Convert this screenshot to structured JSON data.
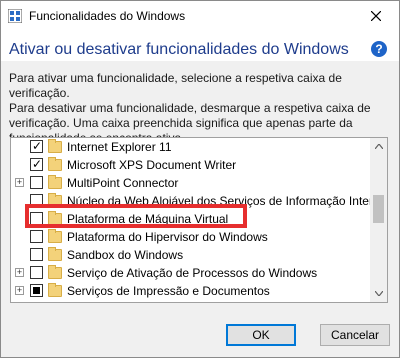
{
  "window": {
    "title": "Funcionalidades do Windows"
  },
  "header": {
    "heading": "Ativar ou desativar funcionalidades do Windows",
    "help_glyph": "?"
  },
  "description": [
    "Para ativar uma funcionalidade, selecione a respetiva caixa de verificação.",
    "Para desativar uma funcionalidade, desmarque a respetiva caixa de",
    "verificação. Uma caixa preenchida significa que apenas parte da",
    "funcionalidade se encontra ativa."
  ],
  "features": [
    {
      "label": "Internet Explorer 11",
      "state": "checked",
      "expandable": false
    },
    {
      "label": "Microsoft XPS Document Writer",
      "state": "checked",
      "expandable": false
    },
    {
      "label": "MultiPoint Connector",
      "state": "unchecked",
      "expandable": true
    },
    {
      "label": "Núcleo da Web Alojável dos Serviços de Informação Internet",
      "state": "unchecked",
      "expandable": false
    },
    {
      "label": "Plataforma de Máquina Virtual",
      "state": "unchecked",
      "expandable": false
    },
    {
      "label": "Plataforma do Hipervisor do Windows",
      "state": "unchecked",
      "expandable": false
    },
    {
      "label": "Sandbox do Windows",
      "state": "unchecked",
      "expandable": false
    },
    {
      "label": "Serviço de Ativação de Processos do Windows",
      "state": "unchecked",
      "expandable": true
    },
    {
      "label": "Serviços de Impressão e Documentos",
      "state": "partial",
      "expandable": true
    }
  ],
  "buttons": {
    "ok": "OK",
    "cancel": "Cancelar"
  },
  "colors": {
    "heading": "#1e3c8c",
    "highlight": "#e62e2e",
    "accent": "#0078d7",
    "folder": "#f3d27a"
  }
}
